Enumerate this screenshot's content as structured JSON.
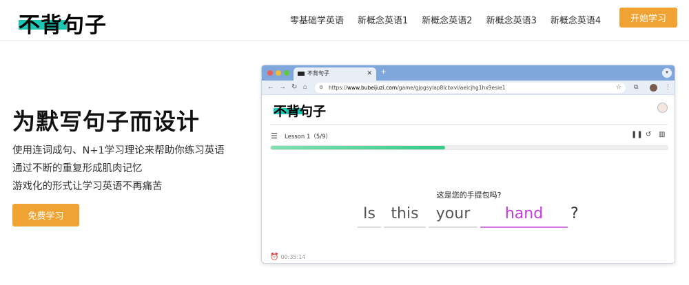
{
  "header": {
    "logo": "不背句子",
    "nav": [
      "零基础学英语",
      "新概念英语1",
      "新概念英语2",
      "新概念英语3",
      "新概念英语4"
    ],
    "start_button": "开始学习"
  },
  "hero": {
    "title": "为默写句子而设计",
    "lines": [
      "使用连词成句、N+1学习理论来帮助你练习英语",
      "通过不断的重复形成肌肉记忆",
      "游戏化的形式让学习英语不再痛苦"
    ],
    "free_button": "免费学习"
  },
  "browser": {
    "tab_title": "不背句子",
    "url_prefix": "https://",
    "url_host": "www.bubeijuzi.com",
    "url_path": "/game/gjogsylap8lcbxvi/aeicjhg1hx9esie1",
    "inner_logo": "不背句子",
    "lesson_label": "Lesson 1（5/9）",
    "progress": 0.44,
    "question": "这是您的手提包吗?",
    "words": [
      "Is",
      "this",
      "your",
      "hand"
    ],
    "active_word_index": 3,
    "end_mark": "?",
    "timer": "00:35:14"
  },
  "icons": {
    "menu": "menu-icon",
    "pause": "pause-icon",
    "replay": "replay-icon",
    "stats": "stats-icon"
  },
  "colors": {
    "accent": "#f0a233",
    "logo_highlight": "#1cc8b4",
    "active_word": "#c03ad8",
    "progress": "#35c98a"
  }
}
